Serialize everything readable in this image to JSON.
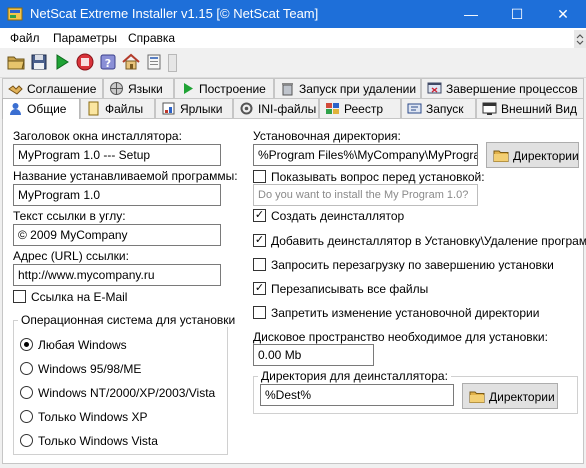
{
  "window": {
    "title": "NetScat Extreme Installer v1.15 [© NetScat Team]",
    "min": "—",
    "max": "☐",
    "close": "✕"
  },
  "menu": [
    "Файл",
    "Параметры",
    "Справка"
  ],
  "toolbar": {
    "icons": [
      "folder-open-icon",
      "save-icon",
      "run-icon",
      "stop-icon",
      "help-icon",
      "home-icon",
      "info-icon"
    ]
  },
  "tabs_row1": [
    {
      "label": "Соглашение",
      "icon": "agreement-icon"
    },
    {
      "label": "Языки",
      "icon": "languages-icon"
    },
    {
      "label": "Построение",
      "icon": "build-icon"
    },
    {
      "label": "Запуск при удалении",
      "icon": "trash-run-icon"
    },
    {
      "label": "Завершение процессов",
      "icon": "process-kill-icon"
    }
  ],
  "tabs_row2": [
    {
      "label": "Общие",
      "icon": "general-icon",
      "active": true
    },
    {
      "label": "Файлы",
      "icon": "files-icon"
    },
    {
      "label": "Ярлыки",
      "icon": "shortcuts-icon"
    },
    {
      "label": "INI-файлы",
      "icon": "ini-files-icon"
    },
    {
      "label": "Реестр",
      "icon": "registry-icon"
    },
    {
      "label": "Запуск",
      "icon": "launch-icon"
    },
    {
      "label": "Внешний Вид",
      "icon": "appearance-icon"
    }
  ],
  "left": {
    "window_title_label": "Заголовок окна инсталлятора:",
    "window_title_value": "MyProgram 1.0 --- Setup",
    "program_name_label": "Название устанавливаемой программы:",
    "program_name_value": "MyProgram 1.0",
    "corner_link_label": "Текст ссылки в углу:",
    "corner_link_value": "© 2009 MyCompany",
    "url_label": "Адрес (URL) ссылки:",
    "url_value": "http://www.mycompany.ru",
    "email_link_label": "Ссылка на E-Mail",
    "email_link_checked": false,
    "os_group_title": "Операционная система для установки",
    "os_options": [
      {
        "label": "Любая Windows",
        "selected": true
      },
      {
        "label": "Windows 95/98/ME",
        "selected": false
      },
      {
        "label": "Windows NT/2000/XP/2003/Vista",
        "selected": false
      },
      {
        "label": "Только Windows XP",
        "selected": false
      },
      {
        "label": "Только Windows Vista",
        "selected": false
      }
    ]
  },
  "right": {
    "install_dir_label": "Установочная директория:",
    "install_dir_value": "%Program Files%\\MyCompany\\MyProgram",
    "dirs_button_label": "Директории",
    "show_question_label": "Показывать вопрос перед установкой:",
    "show_question_checked": false,
    "question_placeholder": "Do you want to install the My Program 1.0?",
    "create_uninstaller_label": "Создать деинсталлятор",
    "create_uninstaller_checked": true,
    "add_to_programs_label": "Добавить деинсталлятор в Установку\\Удаление программ",
    "add_to_programs_checked": true,
    "request_reboot_label": "Запросить перезагрузку по завершению установки",
    "request_reboot_checked": false,
    "overwrite_label": "Перезаписывать все файлы",
    "overwrite_checked": true,
    "forbid_dir_change_label": "Запретить изменение установочной директории",
    "forbid_dir_change_checked": false,
    "disk_space_label": "Дисковое пространство необходимое для установки:",
    "disk_space_value": "0.00 Mb",
    "uninstall_dir_group_title": "Директория для деинсталлятора:",
    "uninstall_dir_value": "%Dest%",
    "uninstall_dirs_button_label": "Директории"
  },
  "colors": {
    "titlebar": "#1e6fd9",
    "panel": "#ffffff",
    "chrome": "#f0f0f0"
  }
}
